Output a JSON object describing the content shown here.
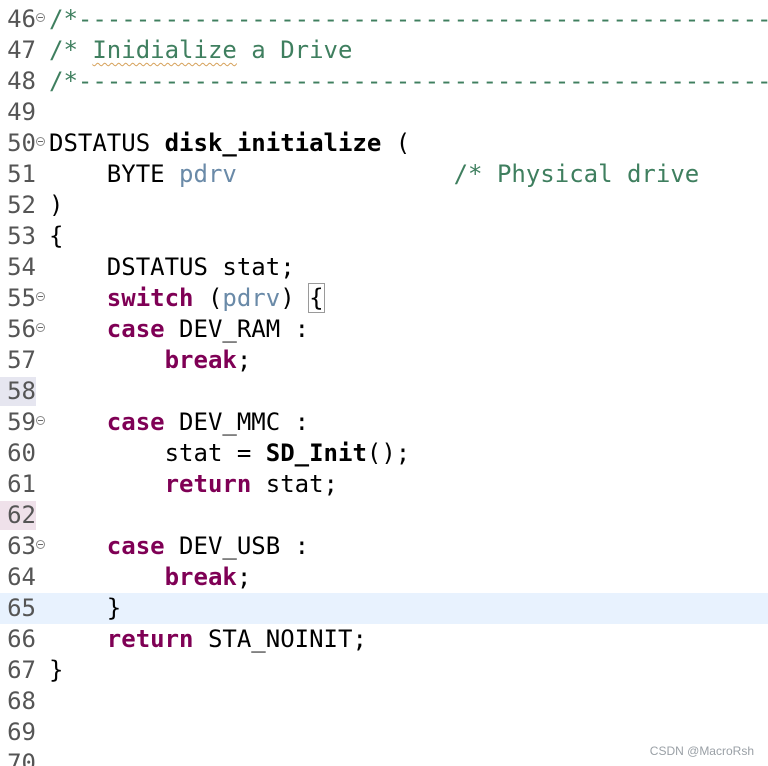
{
  "lines": {
    "46": {
      "num": "46",
      "t1": "/*---------------------------------------------------------"
    },
    "47": {
      "num": "47",
      "t1": "/* ",
      "t2": "Inidialize",
      "t3": " a Drive"
    },
    "48": {
      "num": "48",
      "t1": "/*---------------------------------------------------------"
    },
    "49": {
      "num": "49"
    },
    "50": {
      "num": "50",
      "t1": "DSTATUS ",
      "t2": "disk_initialize",
      "t3": " ("
    },
    "51": {
      "num": "51",
      "t1": "    BYTE ",
      "t2": "pdrv",
      "t3": "               ",
      "t4": "/* Physical drive"
    },
    "52": {
      "num": "52",
      "t1": ")"
    },
    "53": {
      "num": "53",
      "t1": "{"
    },
    "54": {
      "num": "54",
      "t1": "    DSTATUS stat;"
    },
    "55": {
      "num": "55",
      "t1": "    ",
      "t2": "switch",
      "t3": " (",
      "t4": "pdrv",
      "t5": ") ",
      "t6": "{"
    },
    "56": {
      "num": "56",
      "t1": "    ",
      "t2": "case",
      "t3": " DEV_RAM :"
    },
    "57": {
      "num": "57",
      "t1": "        ",
      "t2": "break",
      "t3": ";"
    },
    "58": {
      "num": "58"
    },
    "59": {
      "num": "59",
      "t1": "    ",
      "t2": "case",
      "t3": " DEV_MMC :"
    },
    "60": {
      "num": "60",
      "t1": "        stat = ",
      "t2": "SD_Init",
      "t3": "();"
    },
    "61": {
      "num": "61",
      "t1": "        ",
      "t2": "return",
      "t3": " stat;"
    },
    "62": {
      "num": "62"
    },
    "63": {
      "num": "63",
      "t1": "    ",
      "t2": "case",
      "t3": " DEV_USB :"
    },
    "64": {
      "num": "64",
      "t1": "        ",
      "t2": "break",
      "t3": ";"
    },
    "65": {
      "num": "65",
      "t1": "    }"
    },
    "66": {
      "num": "66",
      "t1": "    ",
      "t2": "return",
      "t3": " STA_NOINIT;"
    },
    "67": {
      "num": "67",
      "t1": "}"
    },
    "68": {
      "num": "68"
    },
    "69": {
      "num": "69"
    },
    "70": {
      "num": "70"
    }
  },
  "watermark": "CSDN @MacroRsh",
  "colors": {
    "comment": "#3f7f5f",
    "keyword": "#7f0055",
    "param": "#6a8aa8",
    "current_line": "#e8f2fe"
  }
}
